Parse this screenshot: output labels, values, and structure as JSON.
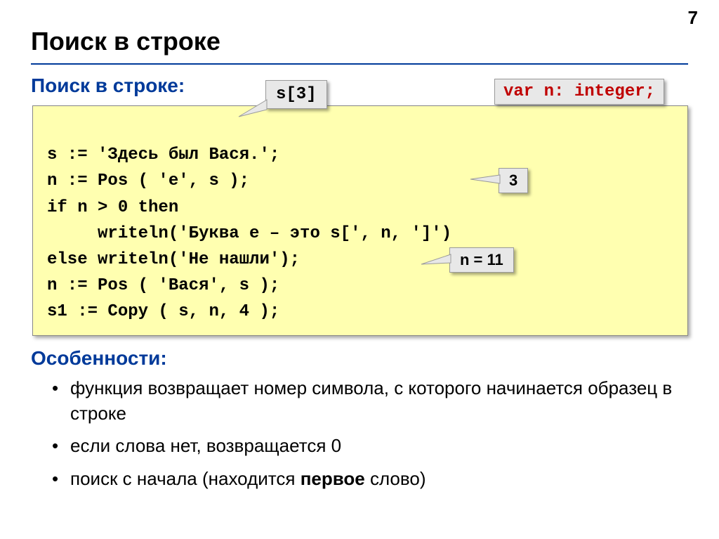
{
  "page_number": "7",
  "title": "Поиск в строке",
  "subtitle": "Поиск в строке:",
  "badge_s3": "s[3]",
  "var_decl": "var n: integer;",
  "code": {
    "l1": "s := 'Здесь был Вася.';",
    "l2": "n := Pos ( 'е', s );",
    "l3": "if n > 0 then",
    "l4": "     writeln('Буква е – это s[', n, ']')",
    "l5": "else writeln('Не нашли');",
    "l6": "n := Pos ( 'Вася', s );",
    "l7": "s1 := Copy ( s, n, 4 );"
  },
  "badge_3": "3",
  "badge_n11": "n = 11",
  "features_title": "Особенности:",
  "features": {
    "f1": "функция возвращает номер символа, с которого начинается образец в строке",
    "f2": "если слова нет, возвращается 0",
    "f3_a": "поиск с начала (находится ",
    "f3_b": "первое",
    "f3_c": " слово)"
  }
}
